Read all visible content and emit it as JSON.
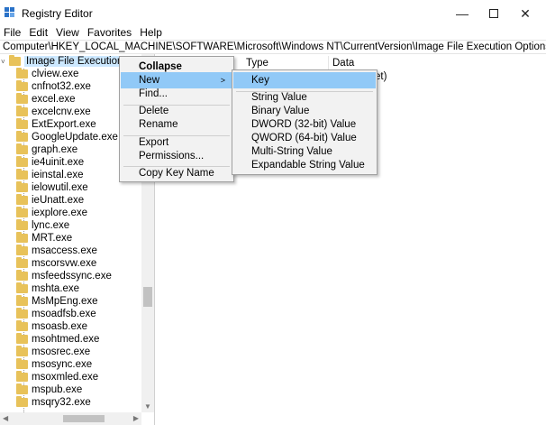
{
  "window": {
    "title": "Registry Editor",
    "minimize": "—",
    "close": "✕"
  },
  "menu": [
    "File",
    "Edit",
    "View",
    "Favorites",
    "Help"
  ],
  "address": "Computer\\HKEY_LOCAL_MACHINE\\SOFTWARE\\Microsoft\\Windows NT\\CurrentVersion\\Image File Execution Options",
  "tree": {
    "root_label": "Image File Execution Opti",
    "items": [
      "clview.exe",
      "cnfnot32.exe",
      "excel.exe",
      "excelcnv.exe",
      "ExtExport.exe",
      "GoogleUpdate.exe",
      "graph.exe",
      "ie4uinit.exe",
      "ieinstal.exe",
      "ielowutil.exe",
      "ieUnatt.exe",
      "iexplore.exe",
      "lync.exe",
      "MRT.exe",
      "msaccess.exe",
      "mscorsvw.exe",
      "msfeedssync.exe",
      "mshta.exe",
      "MsMpEng.exe",
      "msoadfsb.exe",
      "msoasb.exe",
      "msohtmed.exe",
      "msosrec.exe",
      "msosync.exe",
      "msoxmled.exe",
      "mspub.exe",
      "msqry32.exe"
    ]
  },
  "list": {
    "col_type": "Type",
    "col_data": "Data",
    "partial_text": "et)"
  },
  "context_menu": {
    "collapse": "Collapse",
    "new": "New",
    "find": "Find...",
    "delete": "Delete",
    "rename": "Rename",
    "export": "Export",
    "permissions": "Permissions...",
    "copy_key_name": "Copy Key Name"
  },
  "submenu": {
    "key": "Key",
    "string_value": "String Value",
    "binary_value": "Binary Value",
    "dword": "DWORD (32-bit) Value",
    "qword": "QWORD (64-bit) Value",
    "multi_string": "Multi-String Value",
    "expandable_string": "Expandable String Value"
  }
}
